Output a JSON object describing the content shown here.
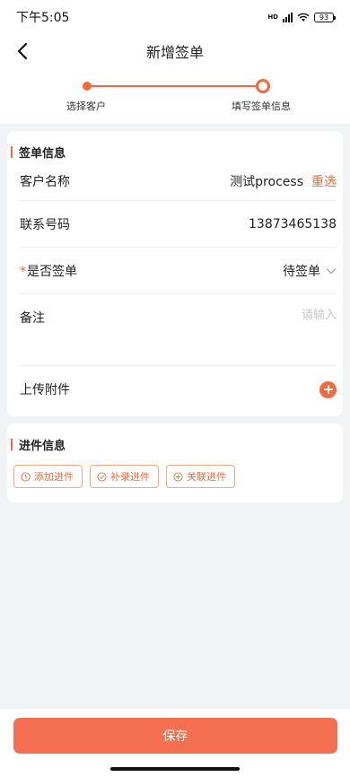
{
  "status_bar": {
    "time": "下午5:05",
    "network_label": "HD",
    "battery": "93"
  },
  "nav": {
    "title": "新增签单"
  },
  "steps": [
    {
      "label": "选择客户"
    },
    {
      "label": "填写签单信息"
    }
  ],
  "sign_info": {
    "title": "签单信息",
    "customer_name_label": "客户名称",
    "customer_name_value": "测试process",
    "reselect_label": "重选",
    "phone_label": "联系号码",
    "phone_value": "13873465138",
    "required_mark": "*",
    "is_signed_label": "是否签单",
    "is_signed_value": "待签单",
    "remark_label": "备注",
    "remark_placeholder": "请输入",
    "upload_label": "上传附件"
  },
  "progress_info": {
    "title": "进件信息",
    "buttons": [
      {
        "label": "添加进件",
        "icon": "clock-icon"
      },
      {
        "label": "补录进件",
        "icon": "check-circle-icon"
      },
      {
        "label": "关联进件",
        "icon": "plus-circle-icon"
      }
    ]
  },
  "footer": {
    "save_label": "保存"
  },
  "colors": {
    "accent": "#f26a3d",
    "save_button": "#f47050",
    "background": "#f2f3f5"
  }
}
